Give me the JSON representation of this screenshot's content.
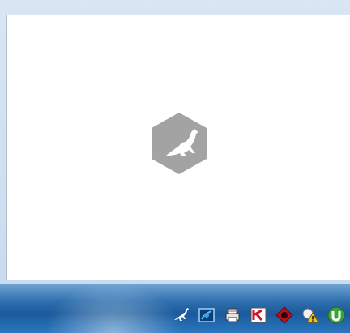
{
  "window": {
    "splash_icon": "kangaroo-hexagon-icon"
  },
  "taskbar": {
    "tray_icons": [
      {
        "name": "kangaroo-tray-icon"
      },
      {
        "name": "network-tray-icon"
      },
      {
        "name": "printer-tray-icon"
      },
      {
        "name": "kaspersky-tray-icon"
      },
      {
        "name": "red-diamond-tray-icon"
      },
      {
        "name": "warning-tray-icon"
      },
      {
        "name": "utorrent-tray-icon"
      }
    ]
  }
}
